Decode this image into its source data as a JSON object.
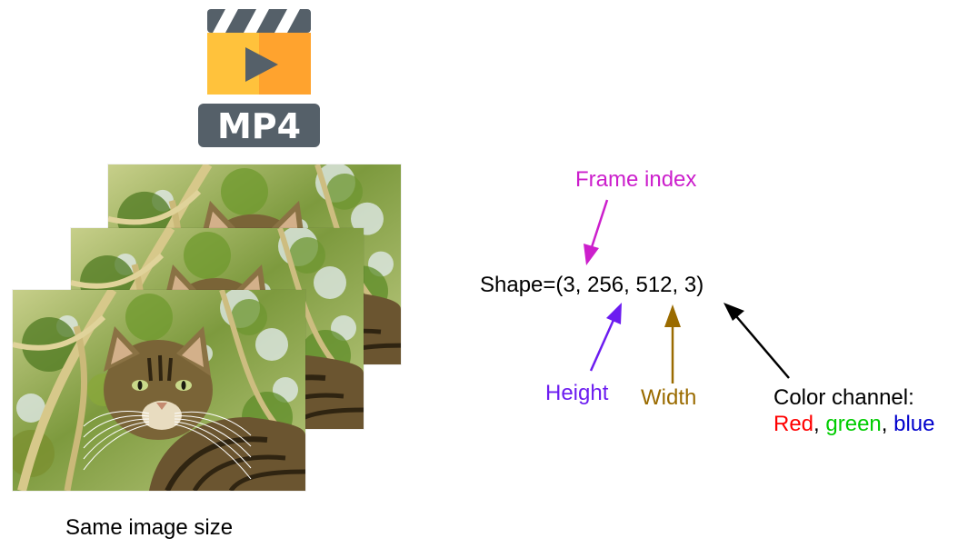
{
  "icon": {
    "name": "mp4-video-icon",
    "badge_text": "MP4",
    "colors": {
      "board": "#556069",
      "body_left": "#ffc23c",
      "body_right": "#ffa32e",
      "play": "#556069",
      "badge_bg": "#556069",
      "badge_text": "#ffffff"
    }
  },
  "frames": {
    "count": 3,
    "image_subject": "tabby-cat",
    "caption": "Same image size"
  },
  "annotation": {
    "shape_text": "Shape=(3, 256, 512, 3)",
    "labels": {
      "frame_index": "Frame index",
      "height": "Height",
      "width": "Width",
      "color_channel": "Color channel:"
    },
    "channels": [
      {
        "name": "Red",
        "color": "#ff0000"
      },
      {
        "name": "green",
        "color": "#00cc00"
      },
      {
        "name": "blue",
        "color": "#0000cc"
      }
    ],
    "separator": ", ",
    "colors": {
      "frame_index": "#cc1fcc",
      "height": "#6c1cf0",
      "width": "#9a6b00",
      "color_channel": "#000000"
    }
  }
}
